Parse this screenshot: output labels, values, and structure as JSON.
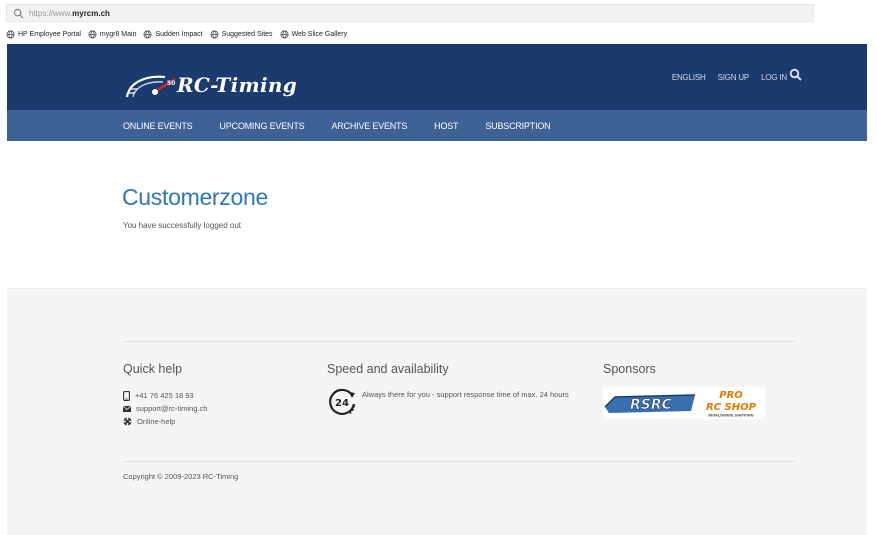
{
  "browser": {
    "url_prefix": "https://www.",
    "url_host": "myrcm.ch",
    "favorites": [
      {
        "label": "HP Employee Portal"
      },
      {
        "label": "mygr8 Main"
      },
      {
        "label": "Sudden Impact"
      },
      {
        "label": "Suggested Sites"
      },
      {
        "label": "Web Slice Gallery"
      }
    ]
  },
  "header": {
    "logo_text": "RC-Timing",
    "logo_badge": "50",
    "links": [
      "ENGLISH",
      "SIGN UP",
      "LOG IN"
    ],
    "search_icon": "search-icon"
  },
  "nav": {
    "items": [
      "ONLINE EVENTS",
      "UPCOMING EVENTS",
      "ARCHIVE EVENTS",
      "HOST",
      "SUBSCRIPTION"
    ]
  },
  "main": {
    "title": "Customerzone",
    "message": "You have successfully logged out"
  },
  "footer": {
    "quick_help": {
      "title": "Quick help",
      "phone": "+41 76 425 18 93",
      "email": "support@rc-timing.ch",
      "help_link": "Online-help"
    },
    "speed": {
      "title": "Speed and availability",
      "badge": "24",
      "text": "Always there for you - support response time of max. 24 hours"
    },
    "sponsors": {
      "title": "Sponsors",
      "logo_left": "RSRC",
      "logo_pro": "PRO",
      "logo_shop": "RC SHOP",
      "logo_tag": "WORLDWIDE SHIPPING"
    },
    "copyright": "Copyright © 2009-2023 RC-Timing"
  },
  "colors": {
    "header_bg": "#1b3a6d",
    "nav_bg": "#3e6196",
    "title": "#2e78b7",
    "footer_bg": "#f5f5f5"
  }
}
